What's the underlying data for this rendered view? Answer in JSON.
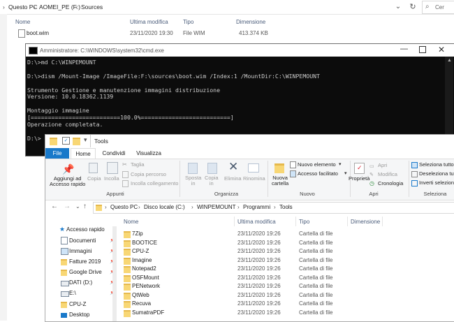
{
  "back_explorer": {
    "breadcrumb": [
      "Questo PC",
      "AOMEI_PE (F:)",
      "Sources"
    ],
    "search_placeholder": "Cer",
    "columns": [
      "Nome",
      "Ultima modifica",
      "Tipo",
      "Dimensione"
    ],
    "file": {
      "name": "boot.wim",
      "date": "23/11/2020 19:30",
      "type": "File WIM",
      "size": "413.374 KB"
    }
  },
  "cmd": {
    "title": "Amministratore: C:\\WINDOWS\\system32\\cmd.exe",
    "lines": [
      "D:\\>md C:\\WINPEMOUNT",
      "",
      "D:\\>dism /Mount-Image /ImageFile:F:\\sources\\boot.wim /Index:1 /MountDir:C:\\WINPEMOUNT",
      "",
      "Strumento Gestione e manutenzione immagini distribuzione",
      "Versione: 10.0.18362.1139",
      "",
      "Montaggio immagine",
      "[==========================100.0%==========================]",
      "Operazione completata.",
      "",
      "D:\\>"
    ]
  },
  "front_explorer": {
    "title": "Tools",
    "tabs": [
      "File",
      "Home",
      "Condividi",
      "Visualizza"
    ],
    "ribbon": {
      "pin": "Aggiungi ad\nAccesso rapido",
      "copy": "Copia",
      "paste": "Incolla",
      "cut": "Taglia",
      "copy_path": "Copia percorso",
      "paste_link": "Incolla collegamento",
      "move": "Sposta\nin",
      "copy_to": "Copia\nin",
      "delete": "Elimina",
      "rename": "Rinomina",
      "new_folder": "Nuova\ncartella",
      "new_item": "Nuovo elemento",
      "easy_access": "Accesso facilitato",
      "properties": "Proprietà",
      "open": "Apri",
      "edit": "Modifica",
      "history": "Cronologia",
      "select_all": "Seleziona tutto",
      "select_none": "Deseleziona tutt",
      "invert": "Inverti selezion",
      "groups": [
        "Appunti",
        "Organizza",
        "Nuovo",
        "Apri",
        "Seleziona"
      ]
    },
    "address": [
      "Questo PC",
      "Disco locale (C:)",
      "WINPEMOUNT",
      "Programmi",
      "Tools"
    ],
    "columns": [
      "Nome",
      "Ultima modifica",
      "Tipo",
      "Dimensione"
    ],
    "nav": [
      "Accesso rapido",
      "Documenti",
      "Immagini",
      "Fatture 2019",
      "Google Drive",
      "DATI (D:)",
      "E:\\",
      "CPU-Z",
      "Desktop"
    ],
    "files": [
      {
        "name": "7Zip",
        "date": "23/11/2020 19:26",
        "type": "Cartella di file"
      },
      {
        "name": "BOOTICE",
        "date": "23/11/2020 19:26",
        "type": "Cartella di file"
      },
      {
        "name": "CPU-Z",
        "date": "23/11/2020 19:26",
        "type": "Cartella di file"
      },
      {
        "name": "Imagine",
        "date": "23/11/2020 19:26",
        "type": "Cartella di file"
      },
      {
        "name": "Notepad2",
        "date": "23/11/2020 19:26",
        "type": "Cartella di file"
      },
      {
        "name": "OSFMount",
        "date": "23/11/2020 19:26",
        "type": "Cartella di file"
      },
      {
        "name": "PENetwork",
        "date": "23/11/2020 19:26",
        "type": "Cartella di file"
      },
      {
        "name": "QtWeb",
        "date": "23/11/2020 19:26",
        "type": "Cartella di file"
      },
      {
        "name": "Recuva",
        "date": "23/11/2020 19:26",
        "type": "Cartella di file"
      },
      {
        "name": "SumatraPDF",
        "date": "23/11/2020 19:26",
        "type": "Cartella di file"
      }
    ]
  },
  "colors": {
    "accent": "#1979ca",
    "folder": "#f8d775",
    "cmd_bg": "#0c0c0c",
    "cmd_text": "#cccccc"
  }
}
